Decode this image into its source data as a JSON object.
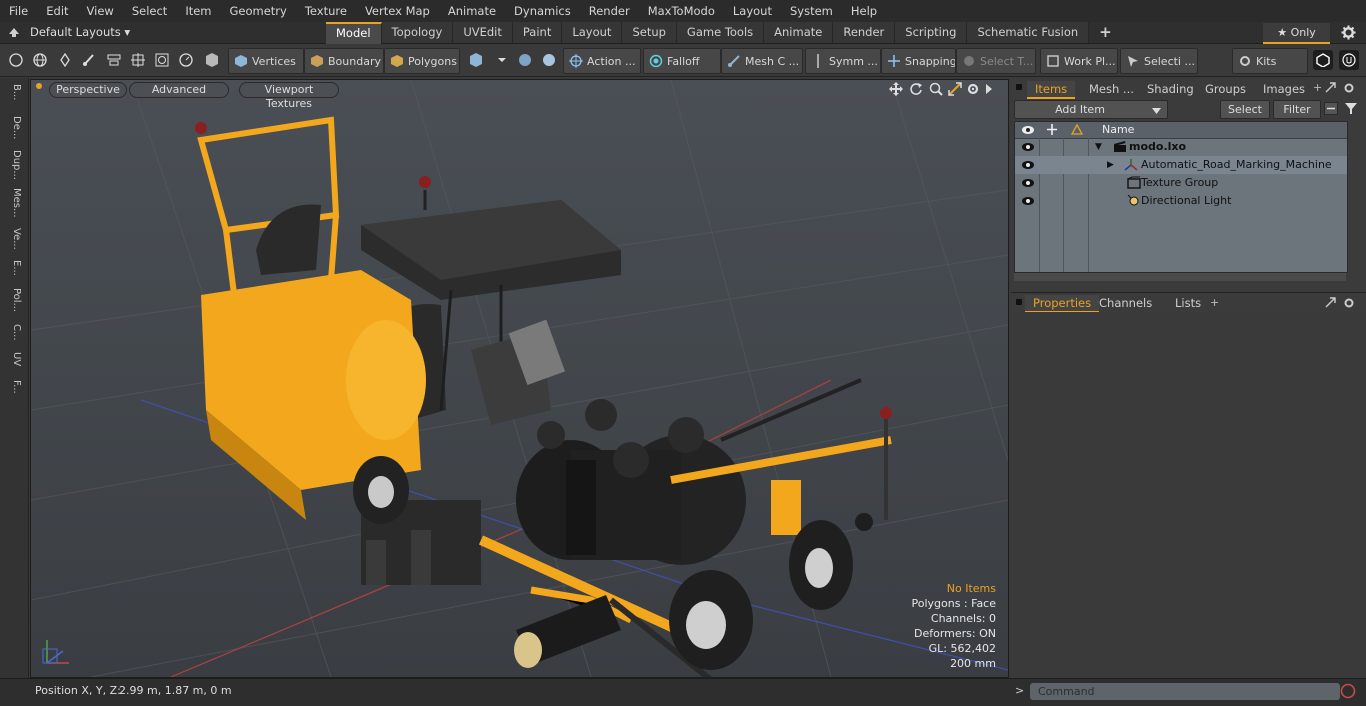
{
  "menu": [
    "File",
    "Edit",
    "View",
    "Select",
    "Item",
    "Geometry",
    "Texture",
    "Vertex Map",
    "Animate",
    "Dynamics",
    "Render",
    "MaxToModo",
    "Layout",
    "System",
    "Help"
  ],
  "layout_dropdown": "Default Layouts ▾",
  "tabs": [
    {
      "label": "Model",
      "active": true
    },
    {
      "label": "Topology",
      "active": false
    },
    {
      "label": "UVEdit",
      "active": false
    },
    {
      "label": "Paint",
      "active": false
    },
    {
      "label": "Layout",
      "active": false
    },
    {
      "label": "Setup",
      "active": false
    },
    {
      "label": "Game Tools",
      "active": false
    },
    {
      "label": "Animate",
      "active": false
    },
    {
      "label": "Render",
      "active": false
    },
    {
      "label": "Scripting",
      "active": false
    },
    {
      "label": "Schematic Fusion",
      "active": false
    }
  ],
  "add_tab": "+",
  "only_button": "★ Only",
  "toolbar": {
    "vertices": "Vertices",
    "boundary": "Boundary",
    "polygons": "Polygons",
    "action": "Action ...",
    "falloff": "Falloff",
    "mesh": "Mesh C ...",
    "symm": "Symm ...",
    "snapping": "Snapping",
    "select_t": "Select T...",
    "work_pl": "Work Pl...",
    "selecti": "Selecti ...",
    "kits": "Kits"
  },
  "left_tabs": [
    "B...",
    "De...",
    "Dup...",
    "Mes...",
    "Ve...",
    "E...",
    "Pol...",
    "C...",
    "UV",
    "F..."
  ],
  "viewport": {
    "perspective": "Perspective",
    "advanced": "Advanced",
    "textures": "Viewport Textures",
    "stats": {
      "no_items": "No Items",
      "polygons": "Polygons : Face",
      "channels": "Channels: 0",
      "deformers": "Deformers: ON",
      "gl": "GL: 562,402",
      "scale": "200 mm"
    }
  },
  "items_panel": {
    "tabs": [
      "Items",
      "Mesh ...",
      "Shading",
      "Groups",
      "Images"
    ],
    "add_item": "Add Item",
    "select": "Select",
    "filter": "Filter",
    "name_col": "Name",
    "rows": [
      {
        "label": "modo.lxo"
      },
      {
        "label": "Automatic_Road_Marking_Machine"
      },
      {
        "label": "Texture Group"
      },
      {
        "label": "Directional Light"
      }
    ]
  },
  "props_panel": {
    "tabs": [
      "Properties",
      "Channels",
      "Lists"
    ],
    "add": "+"
  },
  "status": {
    "position_label": "Position X, Y, Z:",
    "position_value": "2.99 m, 1.87 m, 0 m",
    "command_placeholder": "Command"
  },
  "colors": {
    "accent": "#e9a321",
    "machine_yellow": "#f2a71d",
    "viewport_bg": "#41464b"
  }
}
